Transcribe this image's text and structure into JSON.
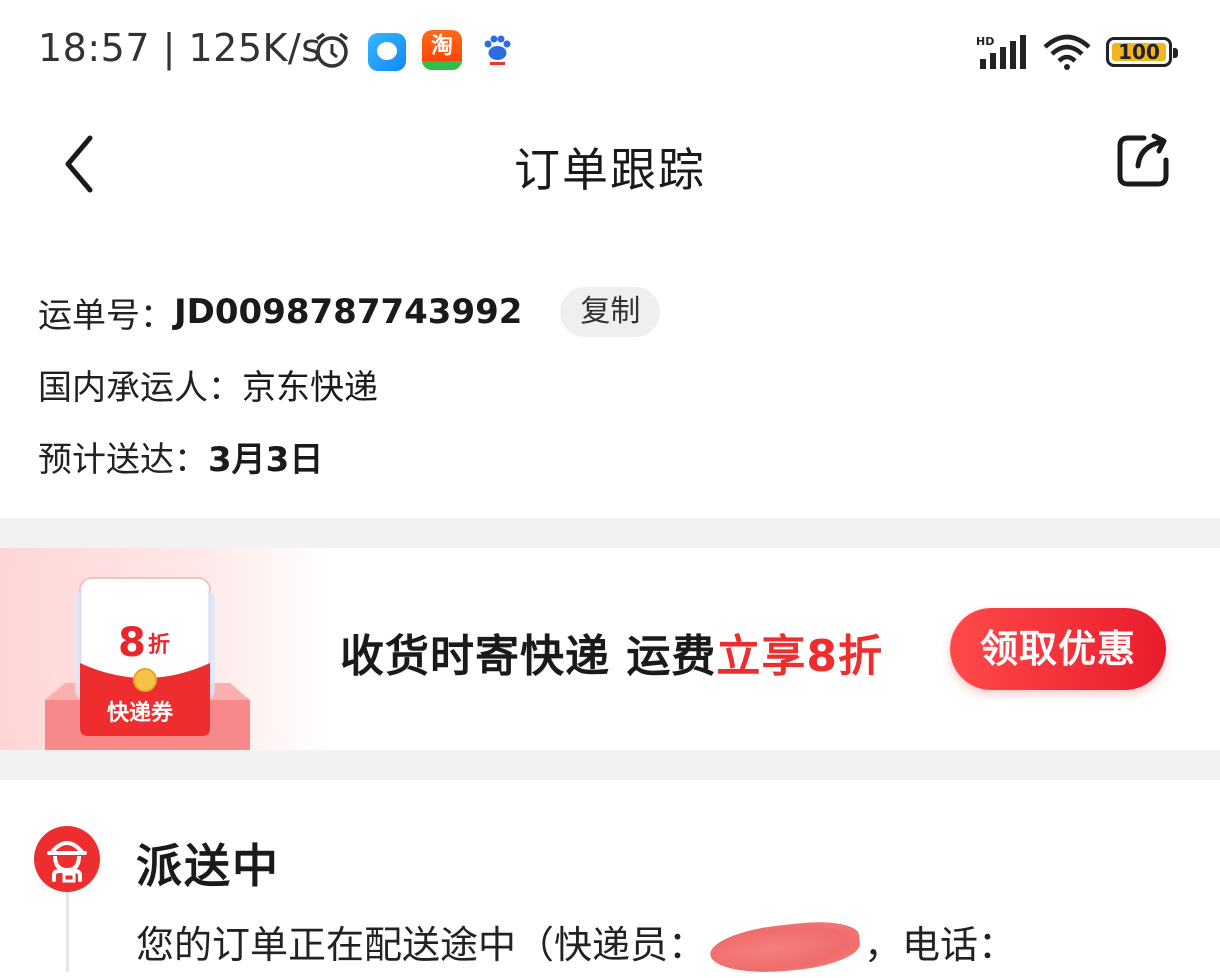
{
  "status_bar": {
    "time": "18:57",
    "speed": "125K/s",
    "network": "HD",
    "battery": "100",
    "app_icons": [
      "alarm-icon",
      "blue-app-icon",
      "taobao-icon",
      "baidu-icon"
    ],
    "taobao_glyph": "淘"
  },
  "header": {
    "title": "订单跟踪",
    "back_icon": "chevron-left-icon",
    "share_icon": "share-icon"
  },
  "waybill": {
    "label": "运单号：",
    "number": "JD0098787743992",
    "copy_label": "复制"
  },
  "carrier": {
    "label": "国内承运人：",
    "name": "京东快递"
  },
  "estimate": {
    "label": "预计送达：",
    "date": "3月3日"
  },
  "promo": {
    "coupon_discount": "8",
    "coupon_unit": "折",
    "coupon_name": "快递券",
    "text_main": "收货时寄快递 运费",
    "text_highlight": "立享8折",
    "button_label": "领取优惠",
    "accent_color": "#ee2e2e"
  },
  "tracking": {
    "status": "派送中",
    "desc_prefix": "您的订单正在配送途中（快递员：",
    "desc_mid": "，电话：",
    "icon": "courier-icon"
  }
}
